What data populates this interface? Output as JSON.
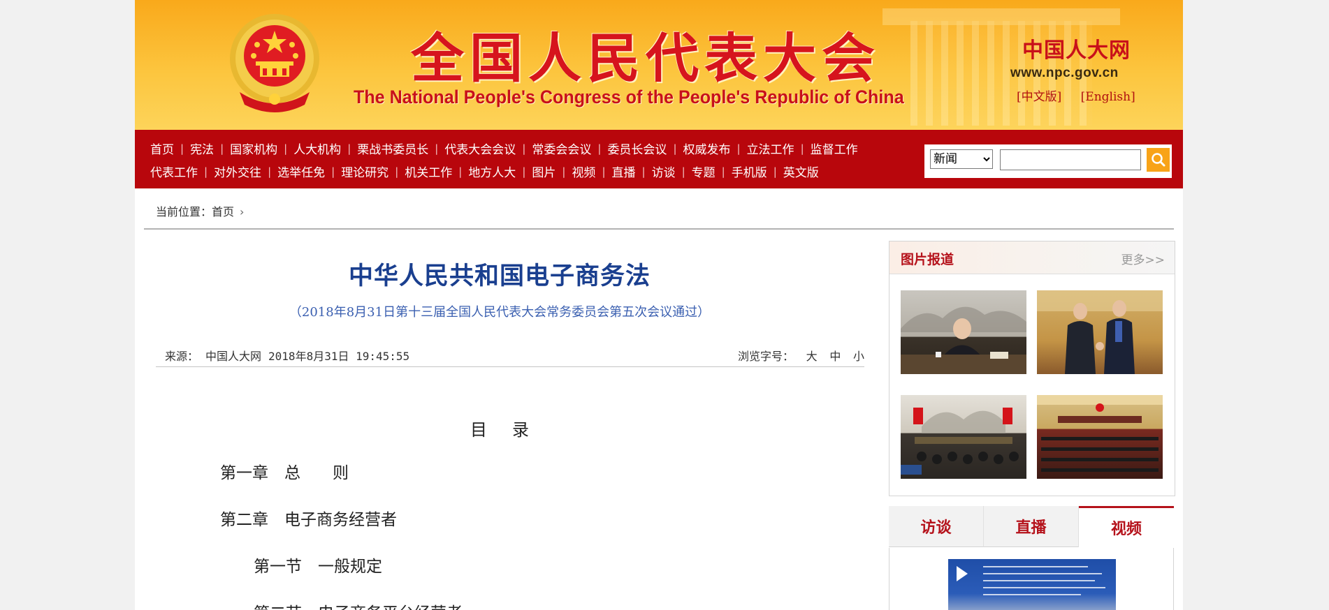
{
  "header": {
    "title_cn": "全国人民代表大会",
    "title_en": "The National People's Congress of the People's Republic of China",
    "site_name": "中国人大网",
    "site_url": "www.npc.gov.cn",
    "lang_cn": "[中文版]",
    "lang_en": "[English]"
  },
  "nav": {
    "row1": [
      "首页",
      "宪法",
      "国家机构",
      "人大机构",
      "栗战书委员长",
      "代表大会会议",
      "常委会会议",
      "委员长会议",
      "权威发布",
      "立法工作",
      "监督工作"
    ],
    "row2": [
      "代表工作",
      "对外交往",
      "选举任免",
      "理论研究",
      "机关工作",
      "地方人大",
      "图片",
      "视频",
      "直播",
      "访谈",
      "专题",
      "手机版",
      "英文版"
    ]
  },
  "search": {
    "category": "新闻",
    "query": "",
    "icon": "search-icon"
  },
  "breadcrumb": {
    "label": "当前位置：",
    "home": "首页"
  },
  "article": {
    "title": "中华人民共和国电子商务法",
    "subtitle": "（2018年8月31日第十三届全国人民代表大会常务委员会第五次会议通过）",
    "source_label": "来源：",
    "source": "中国人大网",
    "datetime": "2018年8月31日  19:45:55",
    "fontsize_label": "浏览字号：",
    "size_large": "大",
    "size_medium": "中",
    "size_small": "小"
  },
  "toc": {
    "heading": "目录",
    "items": [
      "第一章　总　　则",
      "第二章　电子商务经营者",
      "第一节　一般规定",
      "第二节　电子商务平台经营者"
    ]
  },
  "sidebar": {
    "photos_title": "图片报道",
    "photos_more": "更多>>",
    "tabs": [
      "访谈",
      "直播",
      "视频"
    ],
    "active_tab": "视频"
  },
  "colors": {
    "nav_red": "#b8060c",
    "title_blue": "#1a3f8f",
    "accent_red": "#b5121b",
    "search_orange": "#f8a318"
  }
}
